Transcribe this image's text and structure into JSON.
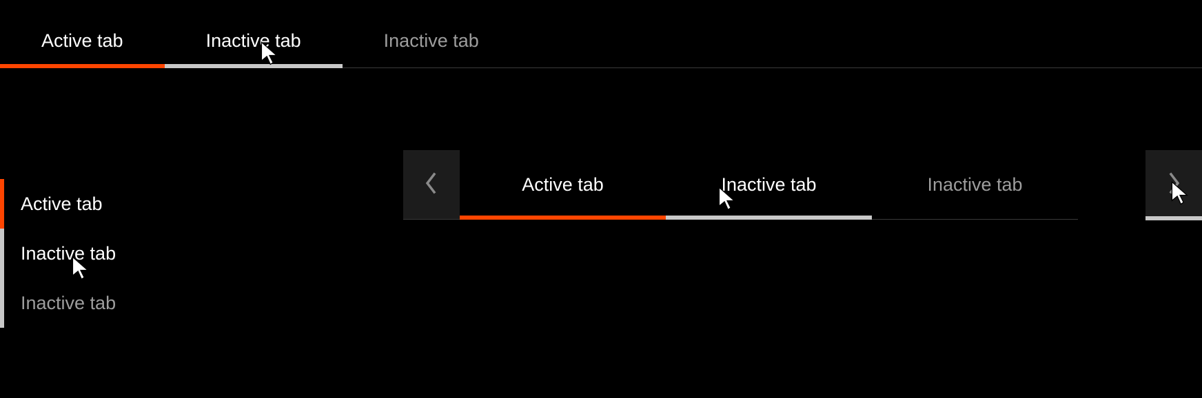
{
  "topTabs": {
    "items": [
      {
        "label": "Active tab",
        "state": "active"
      },
      {
        "label": "Inactive tab",
        "state": "hover"
      },
      {
        "label": "Inactive tab",
        "state": "inactive"
      }
    ]
  },
  "verticalTabs": {
    "items": [
      {
        "label": "Active tab",
        "state": "active"
      },
      {
        "label": "Inactive tab",
        "state": "hover"
      },
      {
        "label": "Inactive tab",
        "state": "inactive"
      }
    ]
  },
  "scrollTabs": {
    "items": [
      {
        "label": "Active tab",
        "state": "active"
      },
      {
        "label": "Inactive tab",
        "state": "hover"
      },
      {
        "label": "Inactive tab",
        "state": "inactive"
      }
    ],
    "leftArrow": "chevron-left-icon",
    "rightArrow": "chevron-right-icon"
  },
  "colors": {
    "accent": "#ff4500",
    "hover": "#c8c8c8",
    "muted": "#9d9d9d",
    "surface": "#1c1c1c"
  }
}
